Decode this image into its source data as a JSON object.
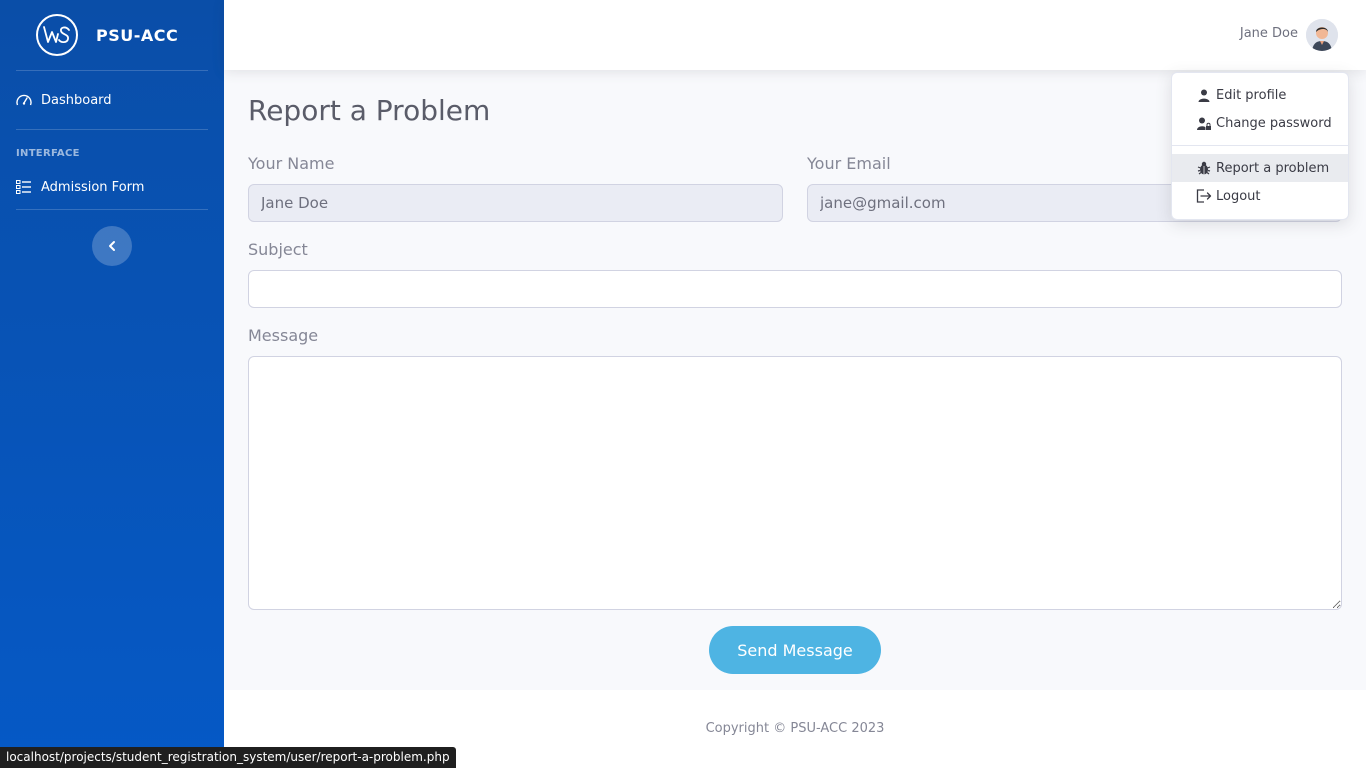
{
  "sidebar": {
    "brand_logo_text": "WS",
    "brand": "PSU-ACC",
    "dashboard": "Dashboard",
    "heading": "INTERFACE",
    "admission": "Admission Form"
  },
  "topbar": {
    "user_name": "Jane Doe"
  },
  "dropdown": {
    "edit_profile": "Edit profile",
    "change_password": "Change password",
    "report_problem": "Report a problem",
    "logout": "Logout"
  },
  "page": {
    "title": "Report a Problem",
    "name_label": "Your Name",
    "name_value": "Jane Doe",
    "email_label": "Your Email",
    "email_value": "jane@gmail.com",
    "subject_label": "Subject",
    "subject_value": "",
    "message_label": "Message",
    "message_value": "",
    "send_button": "Send Message"
  },
  "footer": {
    "copyright": "Copyright © PSU-ACC 2023"
  },
  "statusbar": {
    "url": "localhost/projects/student_registration_system/user/report-a-problem.php"
  },
  "colors": {
    "sidebar_top": "#0a4ea8",
    "sidebar_bottom": "#0559c6",
    "button": "#4eb4e3",
    "background": "#f8f9fc"
  }
}
